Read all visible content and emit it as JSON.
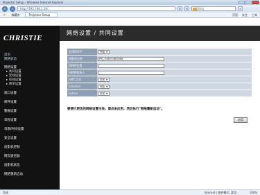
{
  "browser": {
    "window_title": "Projector Setup - Windows Internet Explorer",
    "address": "http://192.168.1.10/",
    "search_placeholder": "Bing",
    "favorites_label": "收藏夹",
    "tab_label": "Projector Setup",
    "toolbar_items": [
      "页面",
      "安全",
      "工具"
    ],
    "status_text": "完成",
    "status_zone": "Internet | 保护模式: 禁用",
    "zoom": "100%"
  },
  "sidebar": {
    "logo": "CHRISTIE",
    "title_lines": [
      "首页",
      "网络状态"
    ],
    "menu": [
      {
        "label": "网络设置",
        "sub": false
      },
      {
        "label": "▸ 共同设置",
        "sub": true
      },
      {
        "label": "▸ 无线设置",
        "sub": true
      },
      {
        "label": "▸ 有线设置",
        "sub": true
      },
      {
        "label": "▸ 简单设置",
        "sub": true
      },
      {
        "label": "端口设置",
        "sub": false
      },
      {
        "label": "邮件设置",
        "sub": false
      },
      {
        "label": "警报设置",
        "sub": false
      },
      {
        "label": "日程设置",
        "sub": false
      },
      {
        "label": "日期/时间设置",
        "sub": false
      },
      {
        "label": "安全设置",
        "sub": false
      },
      {
        "label": "投影机控制",
        "sub": false
      },
      {
        "label": "网页遥控器",
        "sub": false
      },
      {
        "label": "投影机状态",
        "sub": false
      },
      {
        "label": "网络重新启动",
        "sub": false
      }
    ]
  },
  "header": {
    "title": "网络设置 / 共同设置"
  },
  "form": {
    "rows": [
      {
        "label": "无线DHCP",
        "type": "select",
        "value": "开始"
      },
      {
        "label": "投影机名称",
        "type": "text",
        "value": "PRJ_3CBFF0BE0686"
      },
      {
        "label": "SNMP位置",
        "type": "text",
        "value": ""
      },
      {
        "label": "SNMP联系人",
        "type": "text",
        "value": ""
      },
      {
        "label": "AMX D.D.",
        "type": "select",
        "value": "关闭"
      },
      {
        "label": "Crestron",
        "type": "select",
        "value": "开始"
      },
      {
        "label": "Extron",
        "type": "select",
        "value": "关闭"
      }
    ],
    "notice": "要使已更改的网络设置生效，请点击应用，然后执行\"网络重新启动\"。",
    "apply_label": "应用"
  }
}
